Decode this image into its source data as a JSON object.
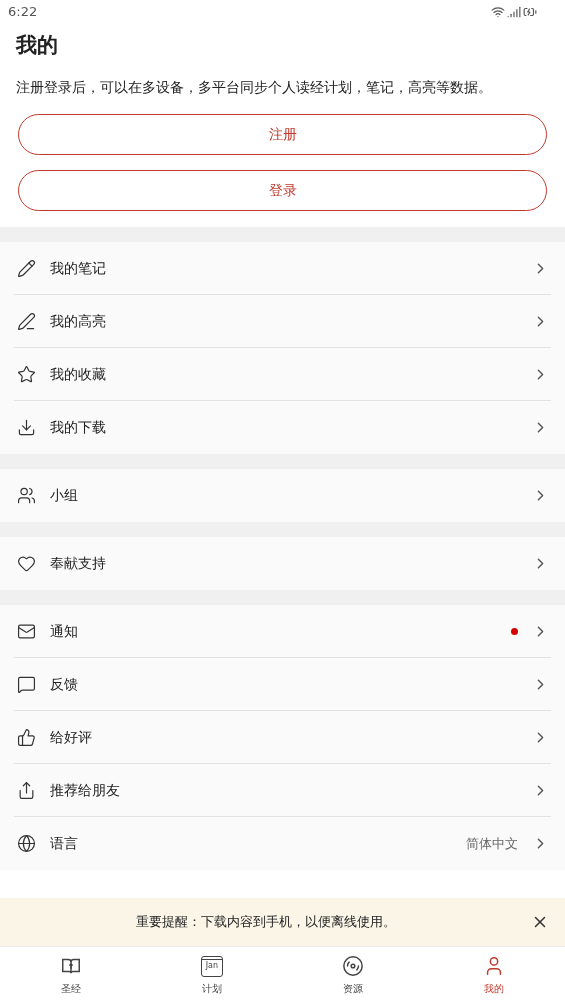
{
  "status_bar": {
    "time": "6:22"
  },
  "title": "我的",
  "description": "注册登录后，可以在多设备，多平台同步个人读经计划，笔记，高亮等数据。",
  "buttons": [
    "注册",
    "登录"
  ],
  "groups": [
    {
      "items": [
        {
          "label": "我的笔记",
          "unread": false
        },
        {
          "label": "我的高亮",
          "unread": false
        },
        {
          "label": "我的收藏",
          "unread": false
        },
        {
          "label": "我的下载",
          "unread": false
        }
      ]
    },
    {
      "items": [
        {
          "label": "小组",
          "unread": false
        }
      ]
    },
    {
      "items": [
        {
          "label": "奉献支持",
          "unread": false
        }
      ]
    },
    {
      "items": [
        {
          "label": "通知",
          "unread": true
        },
        {
          "label": "反馈",
          "unread": false
        },
        {
          "label": "给好评",
          "unread": false
        },
        {
          "label": "推荐给朋友",
          "unread": false
        },
        {
          "label": "语言",
          "unread": false,
          "value": "简体中文"
        }
      ]
    }
  ],
  "banner": {
    "text": "重要提醒：下载内容到手机，以便离线使用。"
  },
  "tabs": [
    {
      "label": "圣经",
      "selected": false
    },
    {
      "label": "计划",
      "icon_text": "Jan",
      "selected": false
    },
    {
      "label": "资源",
      "selected": false
    },
    {
      "label": "我的",
      "selected": true
    }
  ]
}
